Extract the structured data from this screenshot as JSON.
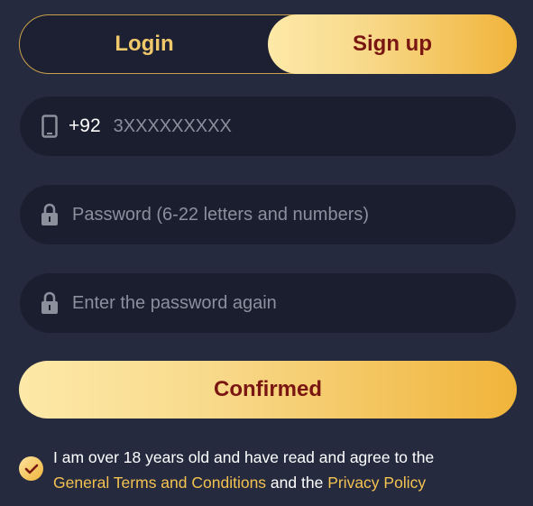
{
  "tabs": {
    "login": "Login",
    "signup": "Sign up",
    "active": "signup"
  },
  "phone": {
    "prefix": "+92",
    "placeholder": "3XXXXXXXXX",
    "icon": "phone-icon"
  },
  "password": {
    "placeholder": "Password (6-22 letters and numbers)",
    "icon": "lock-icon"
  },
  "confirm_password": {
    "placeholder": "Enter the password again",
    "icon": "lock-icon"
  },
  "confirm_button": "Confirmed",
  "agreement": {
    "checked": true,
    "text_1": "I am over 18 years old and have read and agree to the",
    "terms_link": "General Terms and Conditions",
    "text_2": " and the ",
    "privacy_link": "Privacy Policy"
  },
  "colors": {
    "background": "#252a3f",
    "field": "#1b1e2e",
    "accent_gold": "#f0b43a",
    "accent_text": "#7a1612",
    "link": "#f3c250"
  }
}
